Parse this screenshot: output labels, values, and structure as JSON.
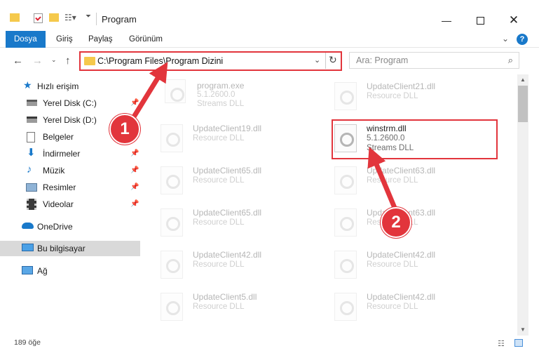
{
  "window": {
    "title": "Program"
  },
  "ribbon": {
    "tabs": [
      {
        "label": "Dosya"
      },
      {
        "label": "Giriş"
      },
      {
        "label": "Paylaş"
      },
      {
        "label": "Görünüm"
      }
    ],
    "help": "?"
  },
  "address": {
    "path": "C:\\Program Files\\Program Dizini"
  },
  "search": {
    "placeholder": "Ara: Program"
  },
  "sidebar": {
    "quick_access": "Hızlı erişim",
    "items": [
      {
        "label": "Yerel Disk (C:)",
        "icon": "drive-icon",
        "pinned": true
      },
      {
        "label": "Yerel Disk (D:)",
        "icon": "drive-icon",
        "pinned": false
      },
      {
        "label": "Belgeler",
        "icon": "documents-icon",
        "pinned": true
      },
      {
        "label": "İndirmeler",
        "icon": "download-icon",
        "pinned": true
      },
      {
        "label": "Müzik",
        "icon": "music-icon",
        "pinned": true
      },
      {
        "label": "Resimler",
        "icon": "pictures-icon",
        "pinned": true
      },
      {
        "label": "Videolar",
        "icon": "videos-icon",
        "pinned": true
      }
    ],
    "onedrive": "OneDrive",
    "this_pc": "Bu bilgisayar",
    "network": "Ağ"
  },
  "files": [
    {
      "name": "program.exe",
      "line1": "5.1.2600.0",
      "line2": "Streams DLL",
      "highlighted": false
    },
    {
      "name": "UpdateClient21.dll",
      "line1": "Resource DLL",
      "line2": "",
      "highlighted": false
    },
    {
      "name": "UpdateClient19.dll",
      "line1": "Resource DLL",
      "line2": "",
      "highlighted": false
    },
    {
      "name": "winstrm.dll",
      "line1": "5.1.2600.0",
      "line2": "Streams DLL",
      "highlighted": true
    },
    {
      "name": "UpdateClient65.dll",
      "line1": "Resource DLL",
      "line2": "",
      "highlighted": false
    },
    {
      "name": "UpdateClient63.dll",
      "line1": "Resource DLL",
      "line2": "",
      "highlighted": false
    },
    {
      "name": "UpdateClient65.dll",
      "line1": "Resource DLL",
      "line2": "",
      "highlighted": false
    },
    {
      "name": "UpdateClient63.dll",
      "line1": "Resource DLL",
      "line2": "",
      "highlighted": false
    },
    {
      "name": "UpdateClient42.dll",
      "line1": "Resource DLL",
      "line2": "",
      "highlighted": false
    },
    {
      "name": "UpdateClient42.dll",
      "line1": "Resource DLL",
      "line2": "",
      "highlighted": false
    },
    {
      "name": "UpdateClient5.dll",
      "line1": "Resource DLL",
      "line2": "",
      "highlighted": false
    },
    {
      "name": "UpdateClient42.dll",
      "line1": "Resource DLL",
      "line2": "",
      "highlighted": false
    }
  ],
  "status": {
    "count": "189 öğe"
  },
  "annotations": {
    "step1": "1",
    "step2": "2",
    "color": "#e2353c"
  }
}
